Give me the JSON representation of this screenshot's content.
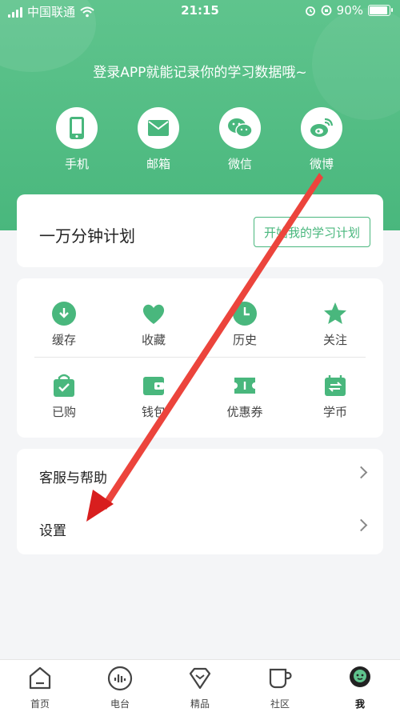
{
  "status_bar": {
    "carrier": "中国联通",
    "time": "21:15",
    "battery": "90%"
  },
  "login": {
    "tip": "登录APP就能记录你的学习数据哦~",
    "options": [
      {
        "label": "手机",
        "icon": "phone-icon"
      },
      {
        "label": "邮箱",
        "icon": "mail-icon"
      },
      {
        "label": "微信",
        "icon": "wechat-icon"
      },
      {
        "label": "微博",
        "icon": "weibo-icon"
      }
    ]
  },
  "plan": {
    "title": "一万分钟计划",
    "button": "开始我的学习计划"
  },
  "features": {
    "row1": [
      {
        "label": "缓存",
        "icon": "download-cloud-icon"
      },
      {
        "label": "收藏",
        "icon": "heart-icon"
      },
      {
        "label": "历史",
        "icon": "clock-icon"
      },
      {
        "label": "关注",
        "icon": "star-icon"
      }
    ],
    "row2": [
      {
        "label": "已购",
        "icon": "bag-icon"
      },
      {
        "label": "钱包",
        "icon": "wallet-icon"
      },
      {
        "label": "优惠券",
        "icon": "coupon-icon"
      },
      {
        "label": "学币",
        "icon": "coin-icon"
      }
    ]
  },
  "menu": [
    {
      "label": "客服与帮助"
    },
    {
      "label": "设置"
    }
  ],
  "tabbar": [
    {
      "label": "首页",
      "icon": "home-icon"
    },
    {
      "label": "电台",
      "icon": "radio-icon"
    },
    {
      "label": "精品",
      "icon": "diamond-icon"
    },
    {
      "label": "社区",
      "icon": "cup-icon"
    },
    {
      "label": "我",
      "icon": "profile-icon",
      "active": true
    }
  ],
  "colors": {
    "brand": "#49b77d",
    "annotation_arrow": "#e02020"
  }
}
